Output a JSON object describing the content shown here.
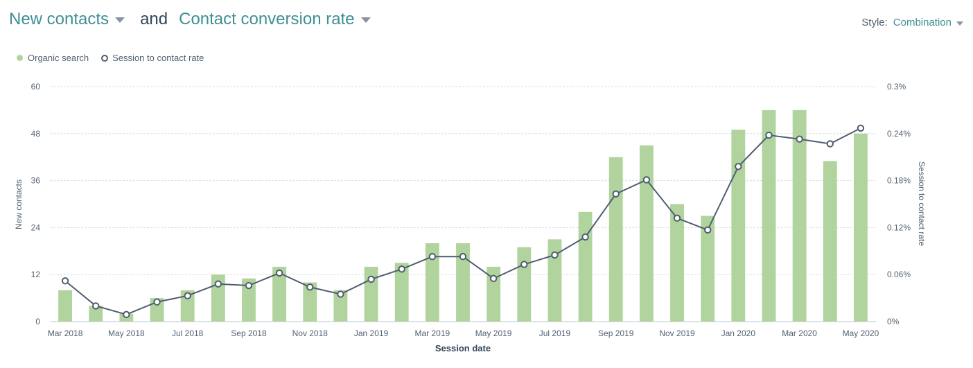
{
  "header": {
    "metric_primary": "New contacts",
    "conjunction": "and",
    "metric_secondary": "Contact conversion rate",
    "style_label": "Style:",
    "style_value": "Combination"
  },
  "legend": {
    "series_bar": "Organic search",
    "series_line": "Session to contact rate"
  },
  "colors": {
    "bar": "#b1d39e",
    "line": "#4f5d70",
    "accent": "#3e8f94",
    "grid": "#d8dde3"
  },
  "chart_data": {
    "type": "bar",
    "combination": true,
    "xlabel": "Session date",
    "ylabel": "New contacts",
    "y2label": "Session to contact rate",
    "ylim": [
      0,
      60
    ],
    "y2lim": [
      0,
      0.3
    ],
    "yticks": [
      "0",
      "12",
      "24",
      "36",
      "48",
      "60"
    ],
    "y2ticks": [
      "0%",
      "0.06%",
      "0.12%",
      "0.18%",
      "0.24%",
      "0.3%"
    ],
    "grid": true,
    "legend_position": "top-left",
    "categories": [
      "Mar 2018",
      "Apr 2018",
      "May 2018",
      "Jun 2018",
      "Jul 2018",
      "Aug 2018",
      "Sep 2018",
      "Oct 2018",
      "Nov 2018",
      "Dec 2018",
      "Jan 2019",
      "Feb 2019",
      "Mar 2019",
      "Apr 2019",
      "May 2019",
      "Jun 2019",
      "Jul 2019",
      "Aug 2019",
      "Sep 2019",
      "Oct 2019",
      "Nov 2019",
      "Dec 2019",
      "Jan 2020",
      "Feb 2020",
      "Mar 2020",
      "Apr 2020",
      "May 2020"
    ],
    "xtick_labels": [
      "Mar 2018",
      "",
      "May 2018",
      "",
      "Jul 2018",
      "",
      "Sep 2018",
      "",
      "Nov 2018",
      "",
      "Jan 2019",
      "",
      "Mar 2019",
      "",
      "May 2019",
      "",
      "Jul 2019",
      "",
      "Sep 2019",
      "",
      "Nov 2019",
      "",
      "Jan 2020",
      "",
      "Mar 2020",
      "",
      "May 2020"
    ],
    "series": [
      {
        "name": "Organic search",
        "type": "bar",
        "axis": "left",
        "values": [
          8,
          4,
          2,
          6,
          8,
          12,
          11,
          14,
          10,
          8,
          14,
          15,
          20,
          20,
          14,
          19,
          21,
          28,
          42,
          45,
          30,
          27,
          49,
          54,
          54,
          41,
          48
        ]
      },
      {
        "name": "Session to contact rate",
        "type": "line",
        "axis": "right",
        "unit": "%",
        "values": [
          0.052,
          0.02,
          0.009,
          0.025,
          0.033,
          0.048,
          0.046,
          0.062,
          0.044,
          0.035,
          0.054,
          0.067,
          0.083,
          0.083,
          0.055,
          0.073,
          0.085,
          0.108,
          0.163,
          0.181,
          0.132,
          0.117,
          0.198,
          0.238,
          0.233,
          0.227,
          0.247
        ]
      }
    ]
  }
}
